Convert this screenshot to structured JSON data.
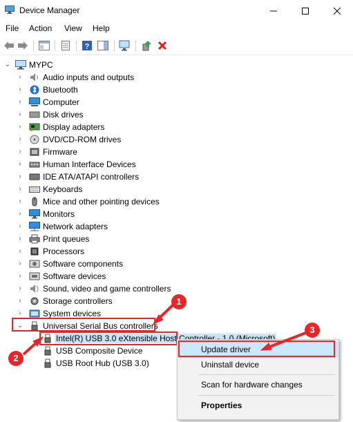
{
  "window": {
    "title": "Device Manager"
  },
  "menu": [
    "File",
    "Action",
    "View",
    "Help"
  ],
  "tree": {
    "root": "MYPC",
    "categories": [
      "Audio inputs and outputs",
      "Bluetooth",
      "Computer",
      "Disk drives",
      "Display adapters",
      "DVD/CD-ROM drives",
      "Firmware",
      "Human Interface Devices",
      "IDE ATA/ATAPI controllers",
      "Keyboards",
      "Mice and other pointing devices",
      "Monitors",
      "Network adapters",
      "Print queues",
      "Processors",
      "Software components",
      "Software devices",
      "Sound, video and game controllers",
      "Storage controllers",
      "System devices"
    ],
    "expanded_category": "Universal Serial Bus controllers",
    "usb_devices": [
      "Intel(R) USB 3.0 eXtensible Host Controller - 1.0 (Microsoft)",
      "USB Composite Device",
      "USB Root Hub (USB 3.0)"
    ]
  },
  "context_menu": {
    "update": "Update driver",
    "uninstall": "Uninstall device",
    "scan": "Scan for hardware changes",
    "properties": "Properties"
  },
  "annotations": [
    "1",
    "2",
    "3"
  ],
  "colors": {
    "annotation": "#e8262a",
    "selection": "#cce4f7",
    "hover": "#cce8ff"
  }
}
